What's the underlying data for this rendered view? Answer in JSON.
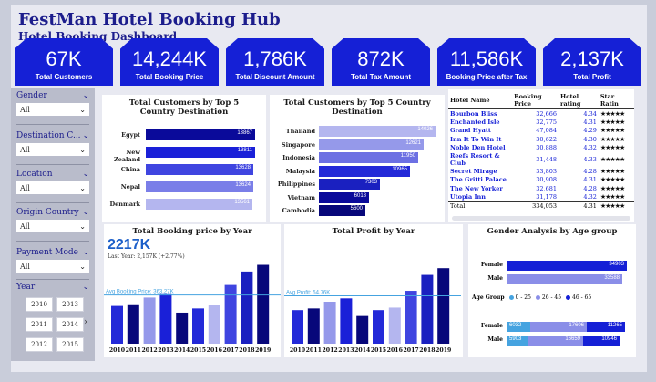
{
  "header": {
    "title": "FestMan Hotel Booking Hub",
    "subtitle": "Hotel Booking Dashboard"
  },
  "kpis": [
    {
      "value": "67K",
      "label": "Total Customers"
    },
    {
      "value": "14,244K",
      "label": "Total Booking Price"
    },
    {
      "value": "1,786K",
      "label": "Total Discount Amount"
    },
    {
      "value": "872K",
      "label": "Total Tax Amount"
    },
    {
      "value": "11,586K",
      "label": "Booking Price after Tax"
    },
    {
      "value": "2,137K",
      "label": "Total Profit"
    }
  ],
  "filters": [
    {
      "label": "Gender",
      "value": "All"
    },
    {
      "label": "Destination C...",
      "value": "All"
    },
    {
      "label": "Location",
      "value": "All"
    },
    {
      "label": "Origin Country",
      "value": "All"
    },
    {
      "label": "Payment Mode",
      "value": "All"
    }
  ],
  "year_filter": {
    "label": "Year",
    "years": [
      "2010",
      "2013",
      "2011",
      "2014",
      "2012",
      "2015"
    ]
  },
  "origin_chart": {
    "title": "Total Customers by Top 5 Country Destination",
    "countries": [
      "Egypt",
      "New Zealand",
      "China",
      "Nepal",
      "Denmark"
    ],
    "values": [
      13867,
      13811,
      13628,
      13624,
      13561
    ],
    "colors": [
      "#0a0a9a",
      "#1a20d8",
      "#3f45e0",
      "#7a7ee8",
      "#b4b6ef"
    ]
  },
  "dest_chart": {
    "title": "Total Customers by Top 5 Country Destination",
    "countries": [
      "Thailand",
      "Singapore",
      "Indonesia",
      "Malaysia",
      "Philippines",
      "Vietnam",
      "Cambodia"
    ],
    "values": [
      14026,
      12621,
      11950,
      10965,
      7303,
      6018,
      5600
    ],
    "colors": [
      "#b4b6ef",
      "#9599ea",
      "#6c70e3",
      "#2329d8",
      "#1a20c0",
      "#0a0a9a",
      "#07077a"
    ]
  },
  "hotel_table": {
    "headers": [
      "Hotel Name",
      "Booking Price",
      "Hotel rating",
      "Star Ratin"
    ],
    "rows": [
      {
        "name": "Bourbon Bliss",
        "price": "32,666",
        "rating": "4.34",
        "stars": "★★★★★"
      },
      {
        "name": "Enchanted Isle",
        "price": "32,775",
        "rating": "4.31",
        "stars": "★★★★★"
      },
      {
        "name": "Grand Hyatt",
        "price": "47,084",
        "rating": "4.29",
        "stars": "★★★★★"
      },
      {
        "name": "Inn It To Win It",
        "price": "30,622",
        "rating": "4.30",
        "stars": "★★★★★"
      },
      {
        "name": "Noble Den Hotel",
        "price": "30,888",
        "rating": "4.32",
        "stars": "★★★★★"
      },
      {
        "name": "Reefs Resort & Club",
        "price": "31,448",
        "rating": "4.33",
        "stars": "★★★★★"
      },
      {
        "name": "Secret Mirage",
        "price": "33,803",
        "rating": "4.28",
        "stars": "★★★★★"
      },
      {
        "name": "The Gritti Palace",
        "price": "30,908",
        "rating": "4.31",
        "stars": "★★★★★"
      },
      {
        "name": "The New Yorker",
        "price": "32,681",
        "rating": "4.28",
        "stars": "★★★★★"
      },
      {
        "name": "Utopia Inn",
        "price": "31,178",
        "rating": "4.32",
        "stars": "★★★★★"
      }
    ],
    "total": {
      "name": "Total",
      "price": "334,053",
      "rating": "4.31",
      "stars": "★★★★★"
    }
  },
  "booking_chart": {
    "title": "Total Booking price by Year",
    "card_value": "2217K",
    "card_sub": "Last Year: 2,157K (+2.77%)",
    "avg_label": "Avg Booking Price: 363.27K",
    "years": [
      "2010",
      "2011",
      "2012",
      "2013",
      "2014",
      "2015",
      "2016",
      "2017",
      "2018",
      "2019"
    ],
    "values": [
      45,
      47,
      55,
      60,
      37,
      42,
      46,
      70,
      86,
      94
    ],
    "colors": [
      "#2329d8",
      "#07077a",
      "#9599ea",
      "#1a20d8",
      "#07077a",
      "#2329d8",
      "#b4b6ef",
      "#3f45e0",
      "#1a20c0",
      "#07077a"
    ]
  },
  "profit_chart": {
    "title": "Total Profit by Year",
    "avg_label": "Avg Profit: 54.76K",
    "years": [
      "2010",
      "2011",
      "2012",
      "2013",
      "2014",
      "2015",
      "2016",
      "2017",
      "2018",
      "2019"
    ],
    "values": [
      40,
      42,
      50,
      54,
      33,
      40,
      43,
      63,
      82,
      90
    ],
    "colors": [
      "#2329d8",
      "#07077a",
      "#9599ea",
      "#1a20d8",
      "#07077a",
      "#2329d8",
      "#b4b6ef",
      "#3f45e0",
      "#1a20c0",
      "#07077a"
    ]
  },
  "gender_chart": {
    "title": "Gender Analysis by Age group",
    "top": [
      {
        "label": "Female",
        "value": "34903",
        "color": "#1520d6"
      },
      {
        "label": "Male",
        "value": "33588",
        "color": "#8a8ee8"
      }
    ],
    "legend_title": "Age Group",
    "legend": [
      {
        "label": "0 - 25",
        "color": "#45a3e0"
      },
      {
        "label": "26 - 45",
        "color": "#8a8ee8"
      },
      {
        "label": "46 - 65",
        "color": "#1520d6"
      }
    ],
    "bottom": [
      {
        "label": "Female",
        "segs": [
          {
            "v": "6032",
            "color": "#45a3e0"
          },
          {
            "v": "17606",
            "color": "#8a8ee8"
          },
          {
            "v": "11265",
            "color": "#1520d6"
          }
        ]
      },
      {
        "label": "Male",
        "segs": [
          {
            "v": "5903",
            "color": "#45a3e0"
          },
          {
            "v": "16659",
            "color": "#8a8ee8"
          },
          {
            "v": "10946",
            "color": "#1520d6"
          }
        ]
      }
    ]
  }
}
